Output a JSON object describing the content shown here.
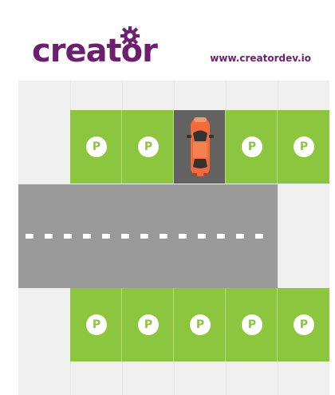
{
  "header": {
    "logo_text": "creator",
    "website": "www.creatordev.io"
  },
  "colors": {
    "brand": "#6b1f6e",
    "spot_free": "#8cc63f",
    "spot_occupied": "#626262",
    "road": "#9a9a9a",
    "car": "#f26b3a"
  },
  "parking": {
    "top_row": [
      {
        "label": "P",
        "occupied": false
      },
      {
        "label": "P",
        "occupied": false
      },
      {
        "label": "",
        "occupied": true
      },
      {
        "label": "P",
        "occupied": false
      },
      {
        "label": "P",
        "occupied": false
      }
    ],
    "bottom_row": [
      {
        "label": "P",
        "occupied": false
      },
      {
        "label": "P",
        "occupied": false
      },
      {
        "label": "P",
        "occupied": false
      },
      {
        "label": "P",
        "occupied": false
      },
      {
        "label": "P",
        "occupied": false
      }
    ]
  }
}
